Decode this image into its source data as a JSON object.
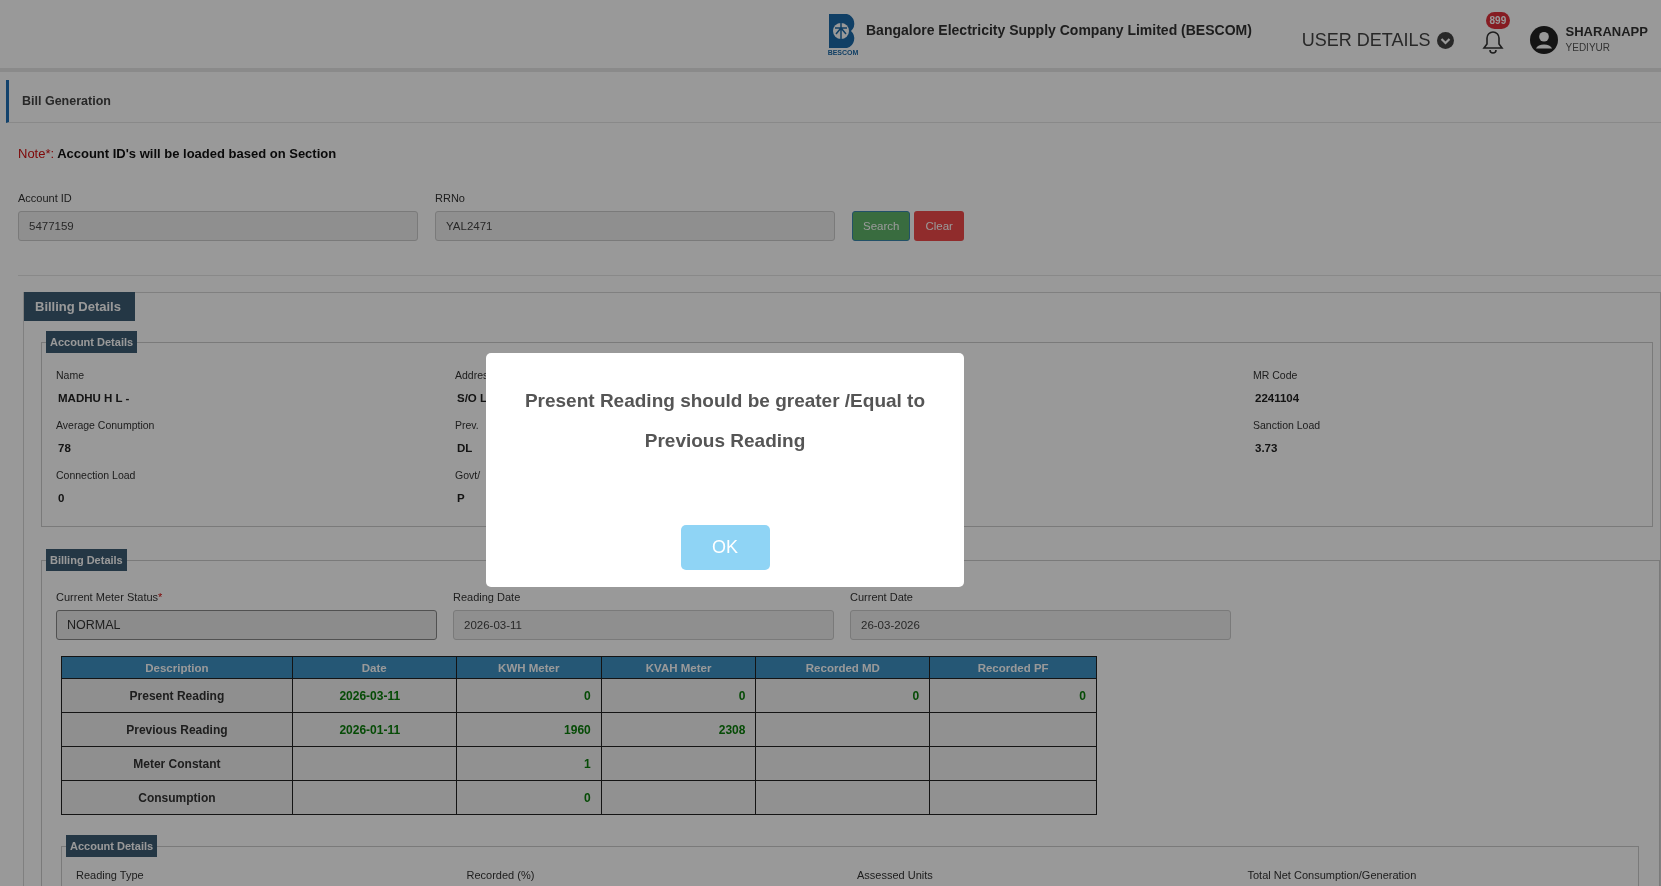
{
  "header": {
    "logo_caption": "BESCOM",
    "company": "Bangalore Electricity Supply Company Limited (BESCOM)",
    "user_details": "USER DETAILS",
    "notifications": "899",
    "user_name": "SHARANAPP",
    "user_location": "YEDIYUR"
  },
  "page_title": "Bill Generation",
  "note": {
    "label": "Note*:",
    "text": "Account ID's will be loaded based on Section"
  },
  "search_form": {
    "fields": [
      {
        "label": "Account ID",
        "value": "5477159"
      },
      {
        "label": "RRNo",
        "value": "YAL2471"
      }
    ],
    "buttons": [
      {
        "label": "Search",
        "kind": "primary"
      },
      {
        "label": "Clear",
        "kind": "danger"
      }
    ]
  },
  "billing_tab": "Billing Details",
  "account_details": {
    "legend": "Account Details",
    "columns": [
      [
        {
          "label": "Name",
          "value": "MADHU H L -"
        },
        {
          "label": "Average Conumption",
          "value": "78"
        },
        {
          "label": "Connection Load",
          "value": "0"
        }
      ],
      [
        {
          "label": "Addres",
          "value": "S/O L"
        },
        {
          "label": "Prev.",
          "value": "DL"
        },
        {
          "label": "Govt/",
          "value": "P"
        }
      ],
      [
        {
          "label": "MR Code",
          "value": "2241104"
        },
        {
          "label": "Sanction Load",
          "value": "3.73"
        }
      ]
    ]
  },
  "billing_details": {
    "legend": "Billing Details",
    "fields": [
      {
        "label": "Current Meter Status",
        "mark": "*",
        "value": "NORMAL",
        "kind": "select"
      },
      {
        "label": "Reading Date",
        "value": "2026-03-11",
        "kind": "readonly"
      },
      {
        "label": "Current Date",
        "value": "26-03-2026",
        "kind": "readonly"
      }
    ],
    "table": {
      "columns": [
        "Description",
        "Date",
        "KWH Meter",
        "KVAH Meter",
        "Recorded MD",
        "Recorded PF"
      ],
      "rows": [
        {
          "cells": [
            "Present Reading",
            "2026-03-11",
            "0",
            "0",
            "0",
            "0"
          ]
        },
        {
          "cells": [
            "Previous Reading",
            "2026-01-11",
            "1960",
            "2308",
            null,
            null
          ]
        },
        {
          "cells": [
            "Meter Constant",
            null,
            "1",
            null,
            null,
            null
          ]
        },
        {
          "cells": [
            "Consumption",
            null,
            "0",
            null,
            null,
            null
          ]
        }
      ]
    }
  },
  "reading_details": {
    "legend": "Account Details",
    "labels": [
      "Reading Type",
      "Recorded (%)",
      "Assessed Units",
      "Total Net Consumption/Generation"
    ]
  },
  "modal": {
    "message": "Present Reading should be greater /Equal to Previous Reading",
    "button": "OK"
  }
}
